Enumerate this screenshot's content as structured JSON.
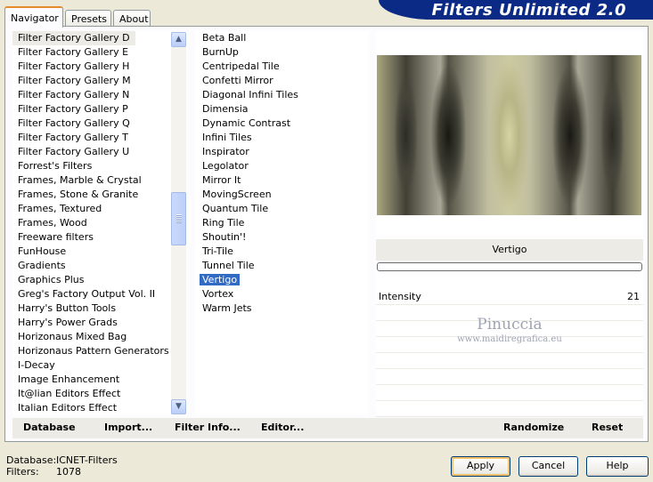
{
  "tabs": [
    {
      "label": "Navigator"
    },
    {
      "label": "Presets"
    },
    {
      "label": "About"
    }
  ],
  "title": "Filters Unlimited 2.0",
  "categories": [
    "Filter Factory Gallery D",
    "Filter Factory Gallery E",
    "Filter Factory Gallery H",
    "Filter Factory Gallery M",
    "Filter Factory Gallery N",
    "Filter Factory Gallery P",
    "Filter Factory Gallery Q",
    "Filter Factory Gallery T",
    "Filter Factory Gallery U",
    "Forrest's Filters",
    "Frames, Marble & Crystal",
    "Frames, Stone & Granite",
    "Frames, Textured",
    "Frames, Wood",
    "Freeware filters",
    "FunHouse",
    "Gradients",
    "Graphics Plus",
    "Greg's Factory Output Vol. II",
    "Harry's Button Tools",
    "Harry's Power Grads",
    "Horizonaus Mixed Bag",
    "Horizonaus Pattern Generators",
    "I-Decay",
    "Image Enhancement",
    "It@lian Editors Effect",
    "Italian Editors Effect"
  ],
  "filters": [
    "Beta Ball",
    "BurnUp",
    "Centripedal Tile",
    "Confetti Mirror",
    "Diagonal Infini Tiles",
    "Dimensia",
    "Dynamic Contrast",
    "Infini Tiles",
    "Inspirator",
    "Legolator",
    "Mirror It",
    "MovingScreen",
    "Quantum Tile",
    "Ring Tile",
    "Shoutin'!",
    "Tri-Tile",
    "Tunnel Tile",
    "Vertigo",
    "Vortex",
    "Warm Jets"
  ],
  "preview": {
    "filter_name": "Vertigo",
    "param_name": "Intensity",
    "param_value": "21",
    "watermark_line1": "Pinuccia",
    "watermark_line2": "www.maidiregrafica.eu"
  },
  "bottom_buttons": {
    "database": "Database",
    "import": "Import...",
    "filter_info": "Filter Info...",
    "editor": "Editor...",
    "randomize": "Randomize",
    "reset": "Reset"
  },
  "status": {
    "database_label": "Database:",
    "database_value": "ICNET-Filters",
    "filters_label": "Filters:",
    "filters_value": "1078"
  },
  "dialog_buttons": {
    "apply": "Apply",
    "cancel": "Cancel",
    "help": "Help"
  }
}
